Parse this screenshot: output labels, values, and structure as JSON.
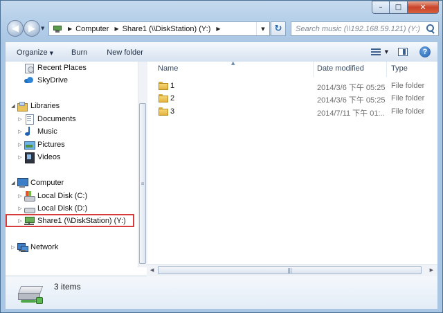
{
  "window": {
    "caption": {
      "minimize": "–",
      "maximize": "□",
      "close": "✕"
    }
  },
  "nav": {
    "back": "◀",
    "forward": "▶",
    "history_drop": "▼",
    "breadcrumbs": [
      "Computer",
      "Share1 (\\\\DiskStation) (Y:)"
    ],
    "address_drop": "▼",
    "refresh": "↻",
    "search_placeholder": "Search music (\\\\192.168.59.121) (Y:)"
  },
  "toolbar": {
    "organize": "Organize",
    "organize_arrow": "▼",
    "burn": "Burn",
    "new_folder": "New folder",
    "views_arrow": "▼",
    "help": "?"
  },
  "sidebar": {
    "items": [
      {
        "label": "Recent Places",
        "icon": "recent-places-icon"
      },
      {
        "label": "SkyDrive",
        "icon": "skydrive-icon"
      },
      {
        "label": "Libraries",
        "icon": "libraries-icon",
        "expanded": true
      },
      {
        "label": "Documents",
        "icon": "documents-icon"
      },
      {
        "label": "Music",
        "icon": "music-icon"
      },
      {
        "label": "Pictures",
        "icon": "pictures-icon"
      },
      {
        "label": "Videos",
        "icon": "videos-icon"
      },
      {
        "label": "Computer",
        "icon": "computer-icon",
        "expanded": true
      },
      {
        "label": "Local Disk (C:)",
        "icon": "local-disk-c-icon"
      },
      {
        "label": "Local Disk (D:)",
        "icon": "local-disk-icon"
      },
      {
        "label": "Share1 (\\\\DiskStation) (Y:)",
        "icon": "network-drive-icon",
        "selected": true
      },
      {
        "label": "Network",
        "icon": "network-icon"
      }
    ],
    "expand_glyph": "▷",
    "expanded_glyph": "◢",
    "scroll_grip": "≡"
  },
  "files": {
    "columns": {
      "name": "Name",
      "date": "Date modified",
      "type": "Type",
      "sort_arrow": "▲"
    },
    "rows": [
      {
        "name": "1",
        "date": "2014/3/6 下午 05:25",
        "type": "File folder"
      },
      {
        "name": "2",
        "date": "2014/3/6 下午 05:25",
        "type": "File folder"
      },
      {
        "name": "3",
        "date": "2014/7/11 下午 01:...",
        "type": "File folder"
      }
    ],
    "hscroll": {
      "left": "◀",
      "right": "▶",
      "grip": "|||"
    }
  },
  "details": {
    "count": "3 items"
  },
  "colors": {
    "highlight_border": "#d83b3b",
    "window_frame": "#b5cfe9"
  }
}
